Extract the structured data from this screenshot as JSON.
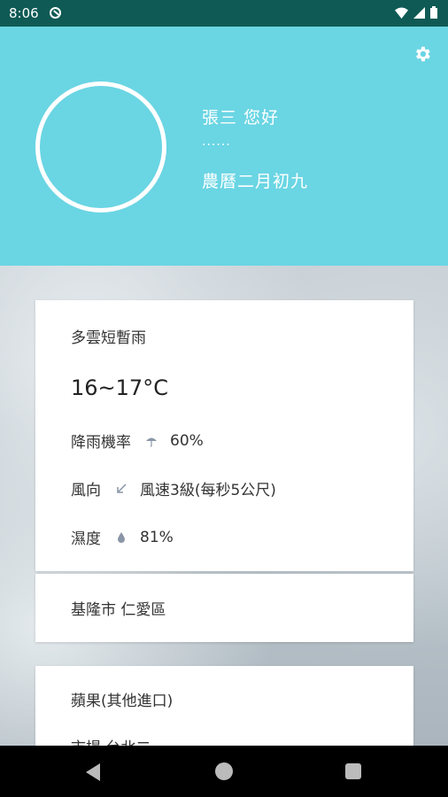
{
  "status_bar": {
    "time": "8:06"
  },
  "header": {
    "greeting": "張三  您好",
    "dots": "......",
    "lunar_date": "農曆二月初九"
  },
  "weather": {
    "condition": "多雲短暫雨",
    "temperature": "16~17°C",
    "rain_label": "降雨機率",
    "rain_value": "60%",
    "wind_label": "風向",
    "wind_value": "風速3級(每秒5公尺)",
    "humidity_label": "濕度",
    "humidity_value": "81%",
    "location": "基隆市 仁愛區"
  },
  "market": {
    "item": "蘋果(其他進口)",
    "location": "市場  台北二"
  },
  "colors": {
    "header_bg": "#6ad5e3",
    "status_bar_bg": "#0f5a55"
  }
}
